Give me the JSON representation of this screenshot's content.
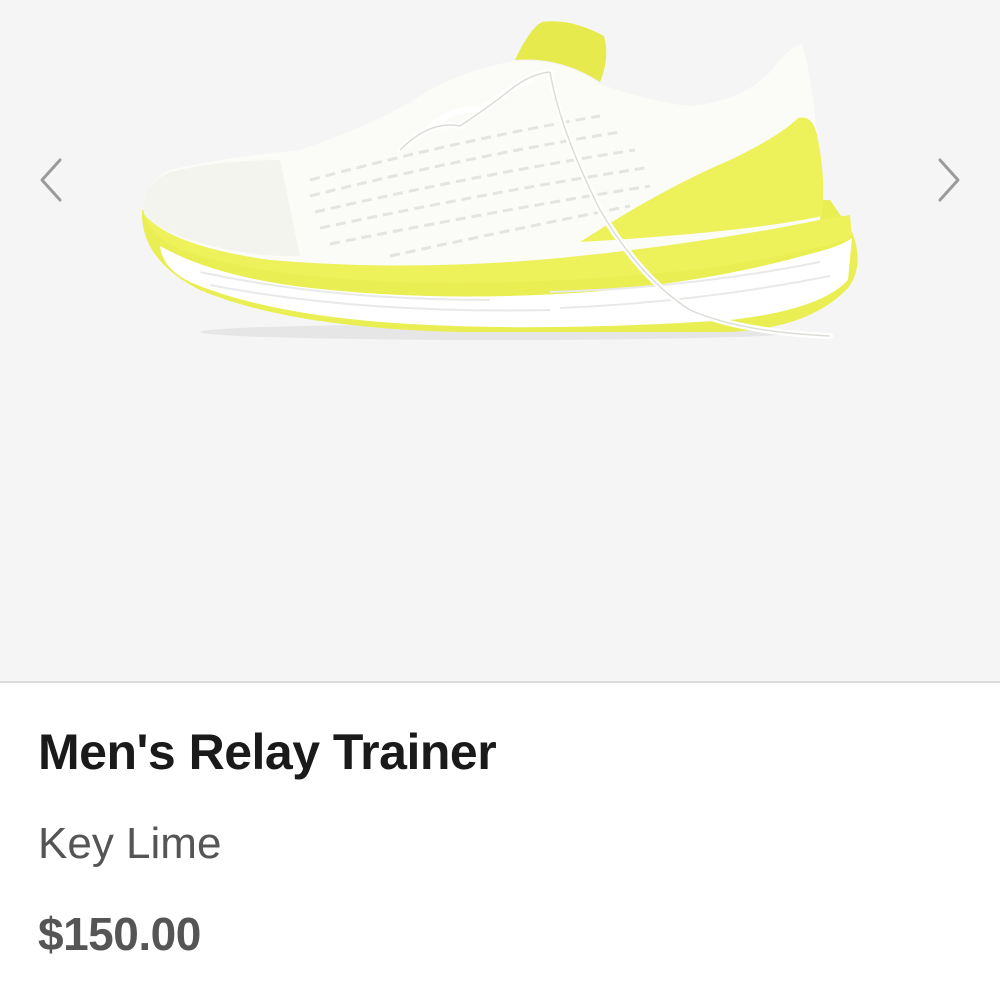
{
  "gallery": {
    "prev_icon": "chevron-left-icon",
    "next_icon": "chevron-right-icon",
    "image_alt": "Men's Relay Trainer in Key Lime",
    "background_color": "#f5f5f5"
  },
  "product": {
    "name": "Men's Relay Trainer",
    "color": "Key Lime",
    "price": "$150.00"
  },
  "colors": {
    "accent_lime": "#eef25a",
    "title_text": "#1a1a1a",
    "secondary_text": "#555555"
  }
}
